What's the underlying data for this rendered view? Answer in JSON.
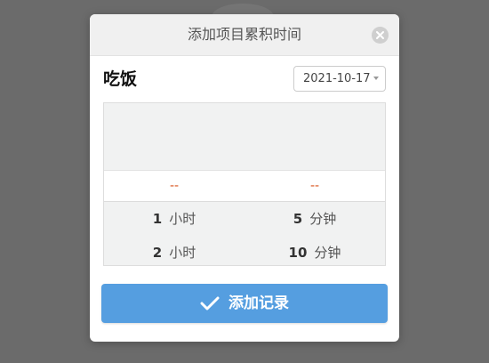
{
  "dialog": {
    "title": "添加项目累积时间",
    "close_icon": "close-icon",
    "project_name": "吃饭",
    "date": {
      "value": "2021-10-17",
      "arrow_icon": "caret-down-icon"
    },
    "picker": {
      "hours": {
        "selected": "--",
        "items": [
          {
            "num": "1",
            "unit": "小时"
          },
          {
            "num": "2",
            "unit": "小时"
          }
        ]
      },
      "minutes": {
        "selected": "--",
        "items": [
          {
            "num": "5",
            "unit": "分钟"
          },
          {
            "num": "10",
            "unit": "分钟"
          }
        ]
      }
    },
    "add_button": {
      "label": "添加记录",
      "icon": "checkmark-icon"
    }
  },
  "colors": {
    "overlay": "#6b6b6b",
    "header_bg": "#f0f0f0",
    "accent_button": "#559ee0",
    "selected_text": "#d9541e",
    "picker_bg": "#f1f2f2"
  }
}
